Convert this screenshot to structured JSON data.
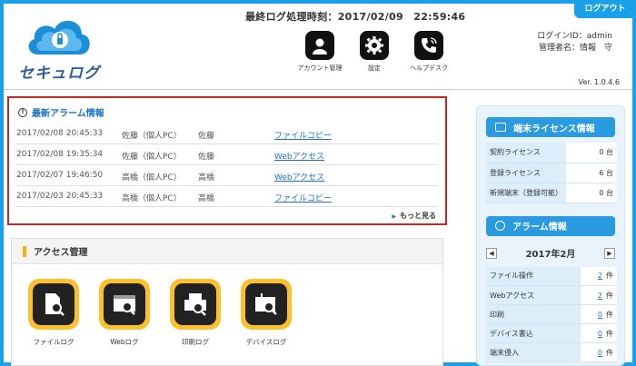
{
  "header": {
    "logout_label": "ログアウト",
    "last_process_label": "最終ログ処理時刻：2017/02/09　22:59:46",
    "logo_text": "セキュログ",
    "nav": [
      {
        "label": "アカウント管理",
        "icon": "user-icon"
      },
      {
        "label": "設定",
        "icon": "gear-icon"
      },
      {
        "label": "ヘルプデスク",
        "icon": "phone-icon"
      }
    ],
    "login_id_line": "ログインID：admin",
    "manager_line": "管理者名：情報　守",
    "version": "Ver. 1.0.4.6"
  },
  "alarm_panel": {
    "title": "最新アラーム情報",
    "rows": [
      {
        "date": "2017/02/08 20:45:33",
        "pc": "佐藤（個人PC）",
        "user": "佐藤",
        "action": "ファイルコピー"
      },
      {
        "date": "2017/02/08 19:35:34",
        "pc": "佐藤（個人PC）",
        "user": "佐藤",
        "action": "Webアクセス"
      },
      {
        "date": "2017/02/07 19:46:50",
        "pc": "高橋（個人PC）",
        "user": "高橋",
        "action": "Webアクセス"
      },
      {
        "date": "2017/02/03 20:45:33",
        "pc": "高橋（個人PC）",
        "user": "高橋",
        "action": "ファイルコピー"
      }
    ],
    "more_label": "もっと見る"
  },
  "access_panel": {
    "title": "アクセス管理",
    "items": [
      {
        "label": "ファイルログ",
        "icon": "file-log-icon"
      },
      {
        "label": "Webログ",
        "icon": "web-log-icon"
      },
      {
        "label": "印刷ログ",
        "icon": "print-log-icon"
      },
      {
        "label": "デバイスログ",
        "icon": "device-log-icon"
      }
    ]
  },
  "license_panel": {
    "title": "端末ライセンス情報",
    "rows": [
      {
        "key": "契約ライセンス",
        "value": "0 台"
      },
      {
        "key": "登録ライセンス",
        "value": "6 台"
      },
      {
        "key": "新規端末（登録可能）",
        "value": "0 台"
      }
    ]
  },
  "alarm_info_panel": {
    "title": "アラーム情報",
    "prev": "◀",
    "next": "▶",
    "month": "2017年2月",
    "rows": [
      {
        "key": "ファイル操作",
        "count": "2",
        "unit": "件"
      },
      {
        "key": "Webアクセス",
        "count": "2",
        "unit": "件"
      },
      {
        "key": "印刷",
        "count": "0",
        "unit": "件"
      },
      {
        "key": "デバイス書込",
        "count": "0",
        "unit": "件"
      },
      {
        "key": "端末侵入",
        "count": "0",
        "unit": "件"
      }
    ]
  }
}
